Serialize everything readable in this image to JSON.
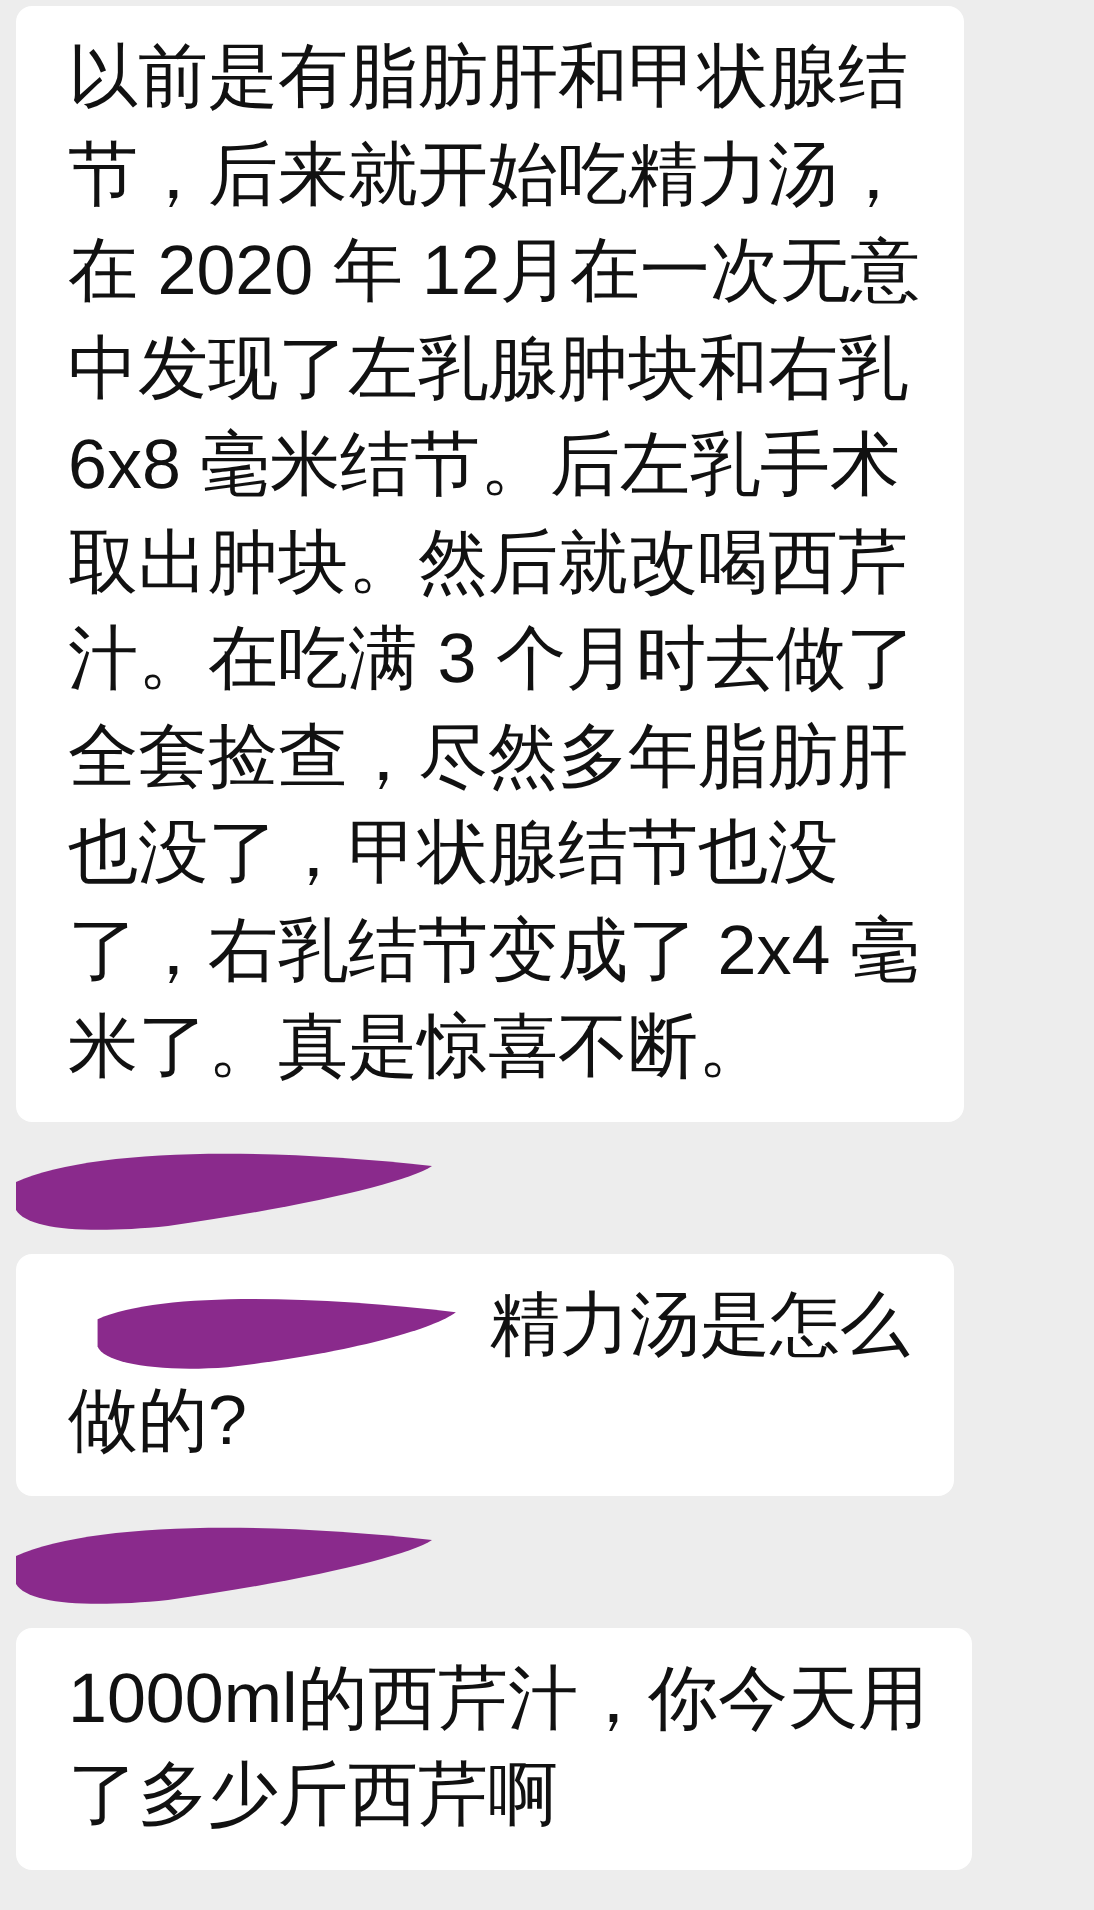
{
  "messages": [
    {
      "sender_redacted": false,
      "covered_start": false,
      "lines": [
        "以前是有脂肪肝和甲状腺结",
        "节，后来就开始吃精力汤，",
        "在 2020 年 12月在一次无意",
        "中发现了左乳腺肿块和右乳",
        "6x8 毫米结节。后左乳手术",
        "取出肿块。然后就改喝西芹",
        "汁。在吃满 3 个月时去做了",
        "全套捡查，尽然多年脂肪肝",
        "也没了，甲状腺结节也没",
        "了，右乳结节变成了 2x4 毫",
        "米了。真是惊喜不断。"
      ]
    },
    {
      "sender_redacted": true,
      "covered_start": true,
      "lines": [
        "精力汤是怎么",
        "做的?"
      ]
    },
    {
      "sender_redacted": true,
      "covered_start": false,
      "lines": [
        "1000ml的西芹汁，你今天用",
        "了多少斤西芹啊"
      ]
    }
  ]
}
